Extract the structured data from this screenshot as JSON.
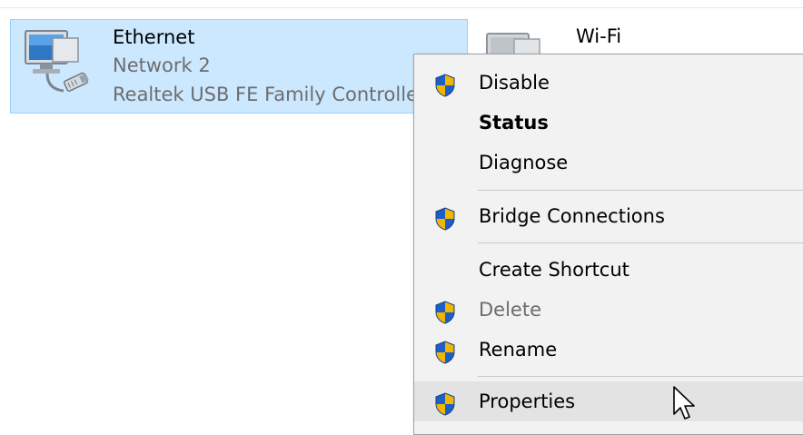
{
  "adapters": [
    {
      "name": "Ethernet",
      "network": "Network  2",
      "device": "Realtek USB FE Family Controller",
      "selected": true
    },
    {
      "name": "Wi-Fi",
      "selected": false
    }
  ],
  "context_menu": {
    "items": [
      {
        "label": "Disable",
        "shield": true
      },
      {
        "label": "Status",
        "bold": true
      },
      {
        "label": "Diagnose"
      },
      {
        "label": "Bridge Connections",
        "shield": true
      },
      {
        "label": "Create Shortcut"
      },
      {
        "label": "Delete",
        "shield": true,
        "disabled": true
      },
      {
        "label": "Rename",
        "shield": true
      },
      {
        "label": "Properties",
        "shield": true,
        "hover": true
      }
    ]
  },
  "colors": {
    "selection_bg": "#cce8ff",
    "selection_border": "#99d1ff",
    "menu_bg": "#f2f2f2",
    "menu_hover": "#e3e3e3",
    "shield_blue": "#1e5fc7",
    "shield_yellow": "#f2b600"
  },
  "icons": [
    "network-adapter-icon",
    "uac-shield-icon",
    "mouse-cursor-icon"
  ]
}
